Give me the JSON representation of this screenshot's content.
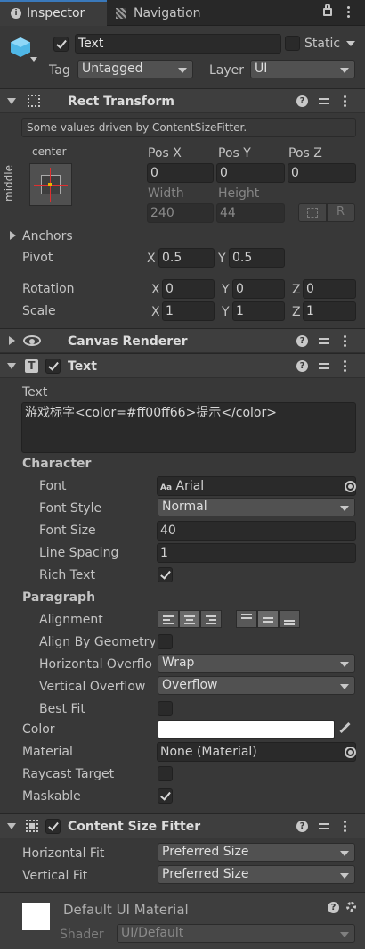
{
  "tabs": {
    "inspector": "Inspector",
    "navigation": "Navigation"
  },
  "object": {
    "name": "Text",
    "static_label": "Static",
    "tag_label": "Tag",
    "tag_value": "Untagged",
    "layer_label": "Layer",
    "layer_value": "UI",
    "active": true,
    "static": false
  },
  "rect_transform": {
    "title": "Rect Transform",
    "notice": "Some values driven by ContentSizeFitter.",
    "anchor_h": "center",
    "anchor_v": "middle",
    "pos_x_label": "Pos X",
    "pos_y_label": "Pos Y",
    "pos_z_label": "Pos Z",
    "pos_x": "0",
    "pos_y": "0",
    "pos_z": "0",
    "width_label": "Width",
    "height_label": "Height",
    "width": "240",
    "height": "44",
    "raw_btn": "R",
    "anchors_label": "Anchors",
    "pivot_label": "Pivot",
    "pivot_x": "0.5",
    "pivot_y": "0.5",
    "rotation_label": "Rotation",
    "rot_x": "0",
    "rot_y": "0",
    "rot_z": "0",
    "scale_label": "Scale",
    "scale_x": "1",
    "scale_y": "1",
    "scale_z": "1",
    "x": "X",
    "y": "Y",
    "z": "Z"
  },
  "canvas_renderer": {
    "title": "Canvas Renderer"
  },
  "text_component": {
    "title": "Text",
    "text_label": "Text",
    "text_value": "游戏标字<color=#ff00ff66>提示</color>",
    "character_label": "Character",
    "font_label": "Font",
    "font_value": "Arial",
    "font_icon": "Aa",
    "font_style_label": "Font Style",
    "font_style_value": "Normal",
    "font_size_label": "Font Size",
    "font_size_value": "40",
    "line_spacing_label": "Line Spacing",
    "line_spacing_value": "1",
    "rich_text_label": "Rich Text",
    "rich_text": true,
    "paragraph_label": "Paragraph",
    "alignment_label": "Alignment",
    "align_geometry_label": "Align By Geometry",
    "align_geometry": false,
    "h_overflow_label": "Horizontal Overflo",
    "h_overflow_value": "Wrap",
    "v_overflow_label": "Vertical Overflow",
    "v_overflow_value": "Overflow",
    "best_fit_label": "Best Fit",
    "best_fit": false,
    "color_label": "Color",
    "color_value": "#ffffff",
    "material_label": "Material",
    "material_value": "None (Material)",
    "raycast_label": "Raycast Target",
    "raycast": false,
    "maskable_label": "Maskable",
    "maskable": true
  },
  "content_size_fitter": {
    "title": "Content Size Fitter",
    "h_fit_label": "Horizontal Fit",
    "h_fit_value": "Preferred Size",
    "v_fit_label": "Vertical Fit",
    "v_fit_value": "Preferred Size"
  },
  "material": {
    "name": "Default UI Material",
    "shader_label": "Shader",
    "shader_value": "UI/Default"
  }
}
